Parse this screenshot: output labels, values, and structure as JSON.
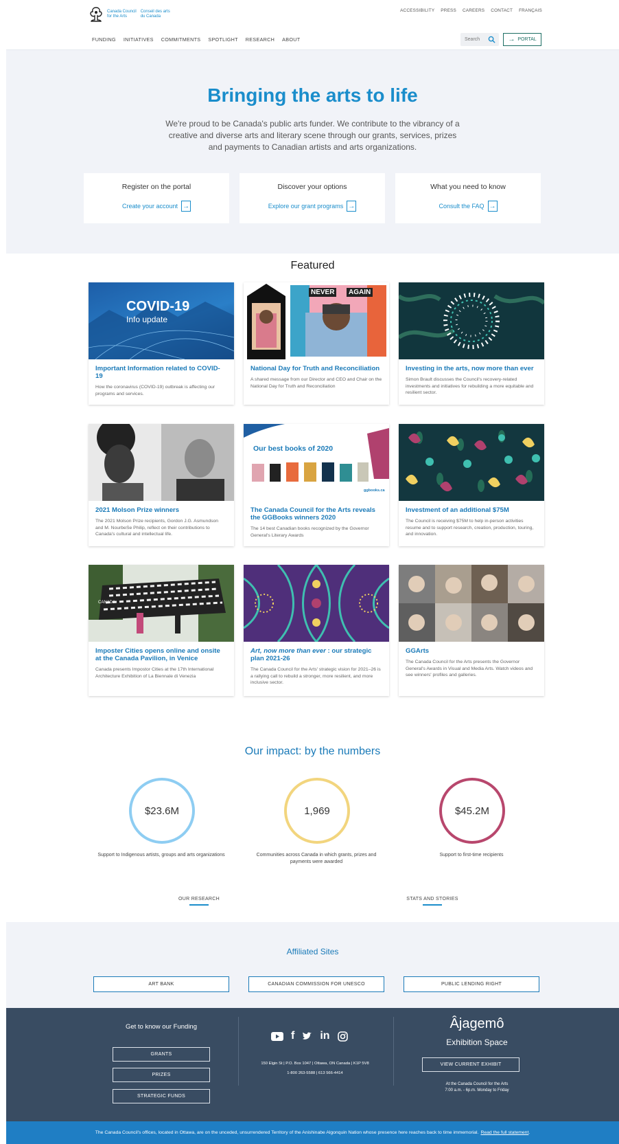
{
  "header": {
    "logo_en": [
      "Canada Council",
      "for the Arts"
    ],
    "logo_fr": [
      "Conseil des arts",
      "du Canada"
    ],
    "utility": [
      "ACCESSIBILITY",
      "PRESS",
      "CAREERS",
      "CONTACT",
      "FRANÇAIS"
    ],
    "nav": [
      "FUNDING",
      "INITIATIVES",
      "COMMITMENTS",
      "SPOTLIGHT",
      "RESEARCH",
      "ABOUT"
    ],
    "search_placeholder": "Search",
    "portal_label": "PORTAL"
  },
  "hero": {
    "title": "Bringing the arts to life",
    "subtitle": "We're proud to be Canada's public arts funder. We contribute to the vibrancy of a creative and diverse arts and literary scene through our grants, services, prizes and payments to Canadian artists and arts organizations.",
    "ctas": [
      {
        "heading": "Register on the portal",
        "link": "Create your account"
      },
      {
        "heading": "Discover your options",
        "link": "Explore our grant programs"
      },
      {
        "heading": "What you need to know",
        "link": "Consult the FAQ"
      }
    ]
  },
  "featured": {
    "title": "Featured",
    "cards": [
      {
        "title": "Important Information related to COVID-19",
        "desc": "How the coronavirus (COVID-19) outbreak is affecting our programs and services.",
        "img_text": "COVID-19",
        "img_sub": "Info update"
      },
      {
        "title": "National Day for Truth and Reconciliation",
        "desc": "A shared message from our Director and CEO and Chair on the National Day for Truth and Reconciliation",
        "img_text": "NEVER",
        "img_sub": "AGAIN"
      },
      {
        "title": "Investing in the arts, now more than ever",
        "desc": "Simon Brault discusses the Council's recovery-related investments and initiatives for rebuilding a more equitable and resilient sector."
      },
      {
        "title": "2021 Molson Prize winners",
        "desc": "The 2021 Molson Prize recipients, Gordon J.G. Asmundson and M. NourbeSe Philip, reflect on their contributions to Canada's cultural and intellectual life."
      },
      {
        "title": "The Canada Council for the Arts reveals the GGBooks winners 2020",
        "desc": "The 14 best Canadian books recognized by the Governor General's Literary Awards",
        "img_text": "Our best books of 2020",
        "img_sub": "ggbooks.ca"
      },
      {
        "title": "Investment of an additional $75M",
        "desc": "The Council is receiving $75M to help in-person activities resume and to support research, creation, production, touring, and innovation."
      },
      {
        "title": "Imposter Cities opens online and onsite at the Canada Pavilion, in Venice",
        "desc": "Canada presents Impostor Cities at the 17th International Architecture Exhibition of La Biennale di Venezia",
        "img_text": "CANADA"
      },
      {
        "title_em": "Art, now more than ever",
        "title_rest": " : our strategic plan 2021-26",
        "desc": "The Canada Council for the Arts' strategic vision for 2021–26 is a rallying call to rebuild a stronger, more resilient, and more inclusive sector."
      },
      {
        "title": "GGArts",
        "desc": "The Canada Council for the Arts presents the Governor General's Awards in Visual and Media Arts. Watch videos and see winners' profiles and galleries."
      }
    ]
  },
  "impact": {
    "title": "Our impact: by the numbers",
    "stats": [
      {
        "value": "$23.6M",
        "caption": "Support to Indigenous artists, groups and arts organizations",
        "color": "#8ecdf2"
      },
      {
        "value": "1,969",
        "caption": "Communities across Canada in which grants, prizes and payments were awarded",
        "color": "#f2d57e"
      },
      {
        "value": "$45.2M",
        "caption": "Support to first-time recipients",
        "color": "#b8476d"
      }
    ],
    "links": [
      "OUR RESEARCH",
      "STATS AND STORIES"
    ]
  },
  "affiliated": {
    "title": "Affiliated Sites",
    "sites": [
      "ART BANK",
      "CANADIAN COMMISSION FOR UNESCO",
      "PUBLIC LENDING RIGHT"
    ]
  },
  "footer": {
    "funding_title": "Get to know our Funding",
    "funding_buttons": [
      "GRANTS",
      "PRIZES",
      "STRATEGIC FUNDS"
    ],
    "social": [
      "youtube-icon",
      "facebook-icon",
      "twitter-icon",
      "linkedin-icon",
      "instagram-icon"
    ],
    "address_line1": "150 Elgin St | P.O. Box 1047 | Ottawa, ON Canada | K1P 5V8",
    "address_line2": "1-800 263-5588 | 613 566-4414",
    "brand_name": "Âjagemô",
    "brand_sub": "Exhibition Space",
    "exhibit_button": "VIEW CURRENT EXHIBIT",
    "hours_line1": "At the Canada Council for the Arts",
    "hours_line2": "7:00 a.m. - 6p.m. Monday to Friday"
  },
  "land_ack": {
    "text": "The Canada Council's offices, located in Ottawa, are on the unceded, unsurrendered Territory of the Anishinabe Algonquin Nation whose presence here reaches back to time immemorial.",
    "link": "Read the full statement"
  }
}
